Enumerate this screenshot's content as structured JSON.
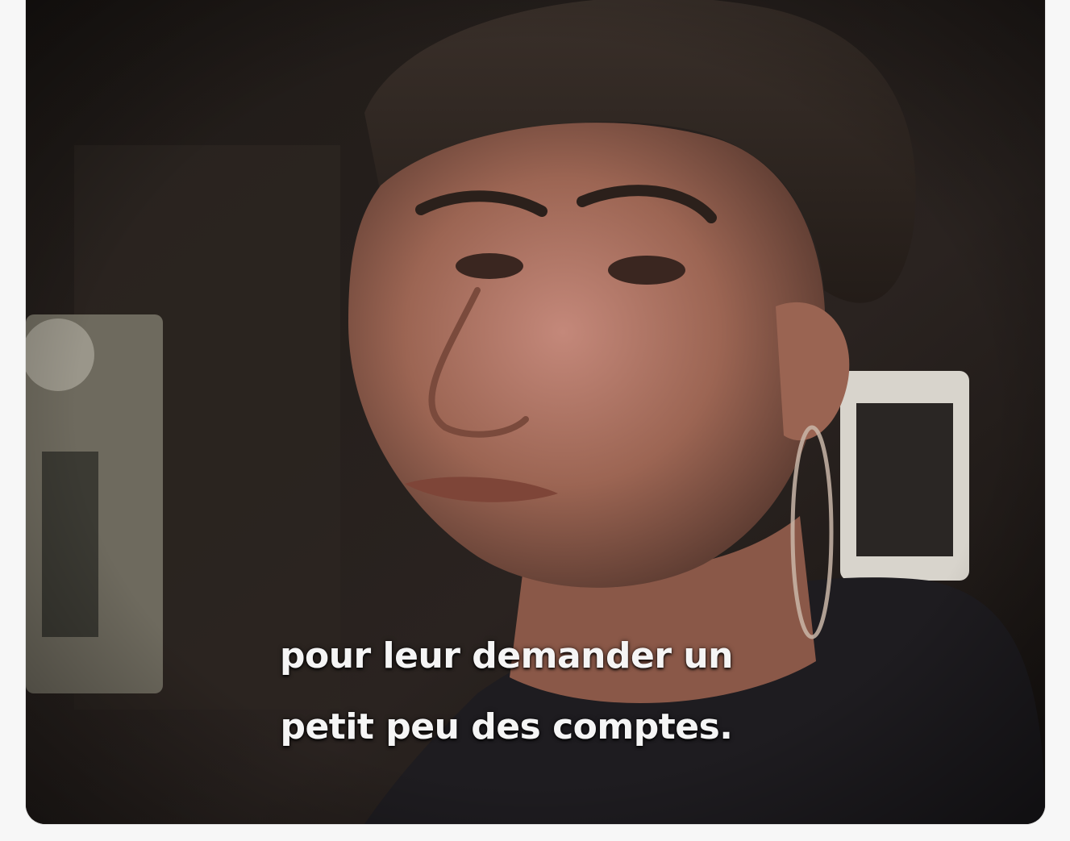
{
  "video": {
    "subtitle_line_1": "pour leur demander un",
    "subtitle_line_2": "petit peu des comptes."
  },
  "colors": {
    "page_background": "#f7f7f7",
    "subtitle_text": "#f5f5f5",
    "scene_dark": "#1a1512",
    "skin_tone": "#a8705a",
    "hair": "#2e2520"
  }
}
